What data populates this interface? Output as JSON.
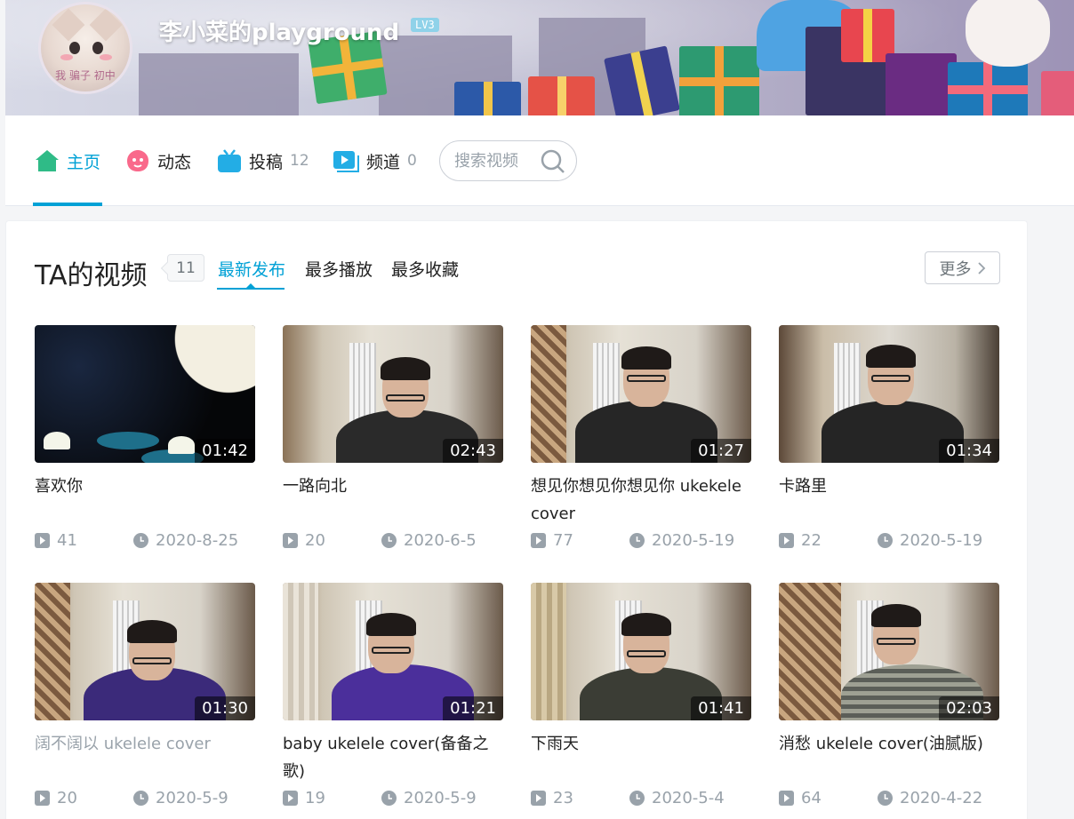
{
  "header": {
    "username": "李小菜的playground",
    "level": "LV3",
    "avatar_caption": "我 骗子 初中"
  },
  "nav": {
    "items": [
      {
        "label": "主页",
        "count": "",
        "icon": "home-icon",
        "color": "#2fbb87"
      },
      {
        "label": "动态",
        "count": "",
        "icon": "face-icon",
        "color": "#f9698b"
      },
      {
        "label": "投稿",
        "count": "12",
        "icon": "tv-icon",
        "color": "#23ade5"
      },
      {
        "label": "频道",
        "count": "0",
        "icon": "play-square-icon",
        "color": "#23ade5"
      }
    ],
    "search_placeholder": "搜索视频"
  },
  "videos": {
    "title": "TA的视频",
    "count": "11",
    "sort_tabs": [
      "最新发布",
      "最多播放",
      "最多收藏"
    ],
    "active_sort": "最新发布",
    "more_label": "更多",
    "items": [
      {
        "title": "喜欢你",
        "duration": "01:42",
        "plays": "41",
        "date": "2020-8-25"
      },
      {
        "title": "一路向北",
        "duration": "02:43",
        "plays": "20",
        "date": "2020-6-5"
      },
      {
        "title": "想见你想见你想见你 ukekele cover",
        "duration": "01:27",
        "plays": "77",
        "date": "2020-5-19"
      },
      {
        "title": "卡路里",
        "duration": "01:34",
        "plays": "22",
        "date": "2020-5-19"
      },
      {
        "title": "阔不阔以 ukelele cover",
        "duration": "01:30",
        "plays": "20",
        "date": "2020-5-9"
      },
      {
        "title": "baby ukelele cover(备备之歌)",
        "duration": "01:21",
        "plays": "19",
        "date": "2020-5-9"
      },
      {
        "title": "下雨天",
        "duration": "01:41",
        "plays": "23",
        "date": "2020-5-4"
      },
      {
        "title": "消愁 ukelele cover(油腻版)",
        "duration": "02:03",
        "plays": "64",
        "date": "2020-4-22"
      }
    ]
  },
  "colors": {
    "accent": "#00a1d6",
    "meta_gray": "#99a2aa",
    "text": "#222222"
  }
}
